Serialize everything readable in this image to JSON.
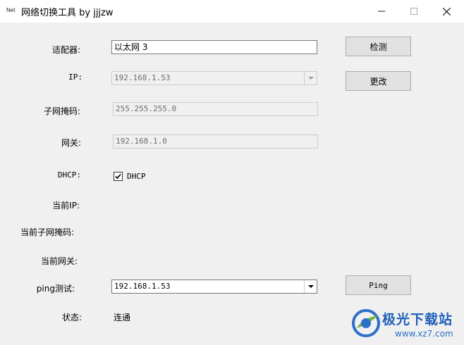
{
  "window": {
    "icon_text": "Net",
    "title": "网络切换工具 by jjjzw"
  },
  "labels": {
    "adapter": "适配器:",
    "ip": "IP:",
    "subnet": "子网掩码:",
    "gateway": "网关:",
    "dhcp": "DHCP:",
    "current_ip": "当前IP:",
    "current_subnet": "当前子网掩码:",
    "current_gateway": "当前网关:",
    "ping": "ping测试:",
    "status": "状态:"
  },
  "fields": {
    "adapter_value": "以太网 3",
    "ip_value": "192.168.1.53",
    "subnet_value": "255.255.255.0",
    "gateway_value": "192.168.1.0",
    "ping_value": "192.168.1.53",
    "status_value": "连通"
  },
  "dhcp": {
    "label": "DHCP",
    "checked": true
  },
  "buttons": {
    "detect": "检测",
    "change": "更改",
    "ping": "Ping"
  },
  "watermark": {
    "brand": "极光下载站",
    "url": "www.xz7.com"
  },
  "colors": {
    "background": "#f0f0f0",
    "titlebar": "#ffffff",
    "watermark_blue": "#1f5fb8"
  },
  "icons": {
    "minimize": "minimize-icon",
    "maximize": "maximize-icon",
    "close": "close-icon",
    "dropdown": "chevron-down-icon",
    "check": "checkmark-icon"
  }
}
